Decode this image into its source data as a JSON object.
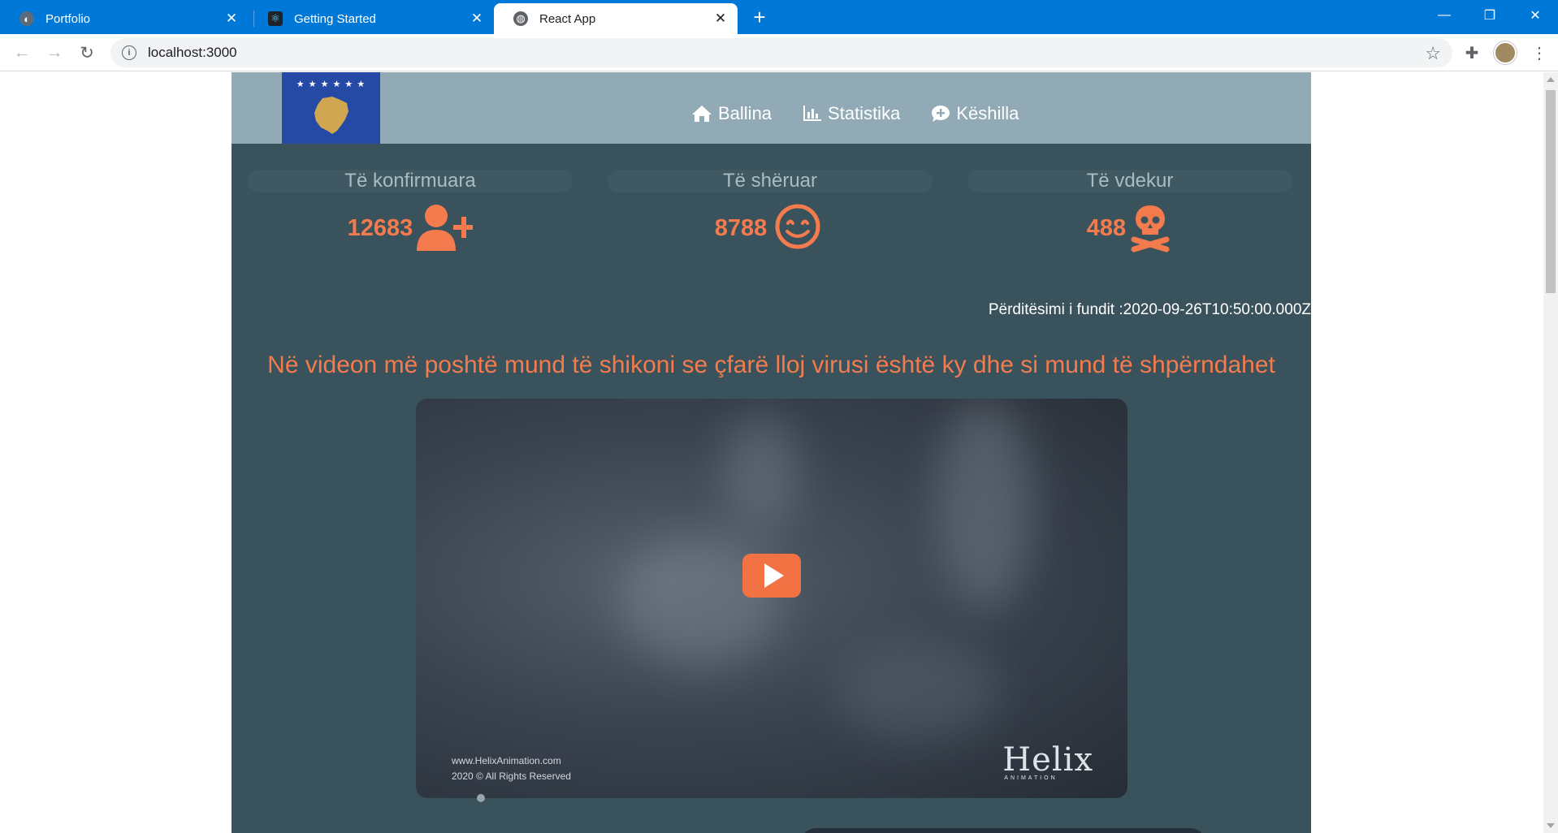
{
  "browser": {
    "tabs": [
      {
        "label": "Portfolio",
        "icon": "portfolio-favicon"
      },
      {
        "label": "Getting Started",
        "icon": "react-favicon"
      },
      {
        "label": "React App",
        "icon": "globe-icon",
        "active": true
      }
    ],
    "url": "localhost:3000"
  },
  "header": {
    "nav": [
      {
        "label": "Ballina",
        "icon": "home-icon"
      },
      {
        "label": "Statistika",
        "icon": "bar-chart-icon"
      },
      {
        "label": "Këshilla",
        "icon": "comment-plus-icon"
      }
    ]
  },
  "stats": {
    "confirmed": {
      "label": "Të konfirmuara",
      "value": "12683",
      "icon": "user-plus-icon"
    },
    "recovered": {
      "label": "Të shëruar",
      "value": "8788",
      "icon": "smile-icon"
    },
    "deaths": {
      "label": "Të vdekur",
      "value": "488",
      "icon": "skull-crossbones-icon"
    }
  },
  "last_updated": "Përditësimi i fundit :2020-09-26T10:50:00.000Z",
  "video": {
    "headline": "Në videon më poshtë mund të shikoni se çfarë lloj virusi është ky dhe si mund të shpërndahet",
    "credit_url": "www.HelixAnimation.com",
    "credit_copy": "2020 © All Rights Reserved",
    "logo_name": "Helix",
    "logo_sub": "ANIMATION"
  },
  "colors": {
    "accent": "#f47b4d",
    "header_bg": "#91aab6",
    "page_bg": "#3a525c",
    "browser_blue": "#0078d7"
  }
}
